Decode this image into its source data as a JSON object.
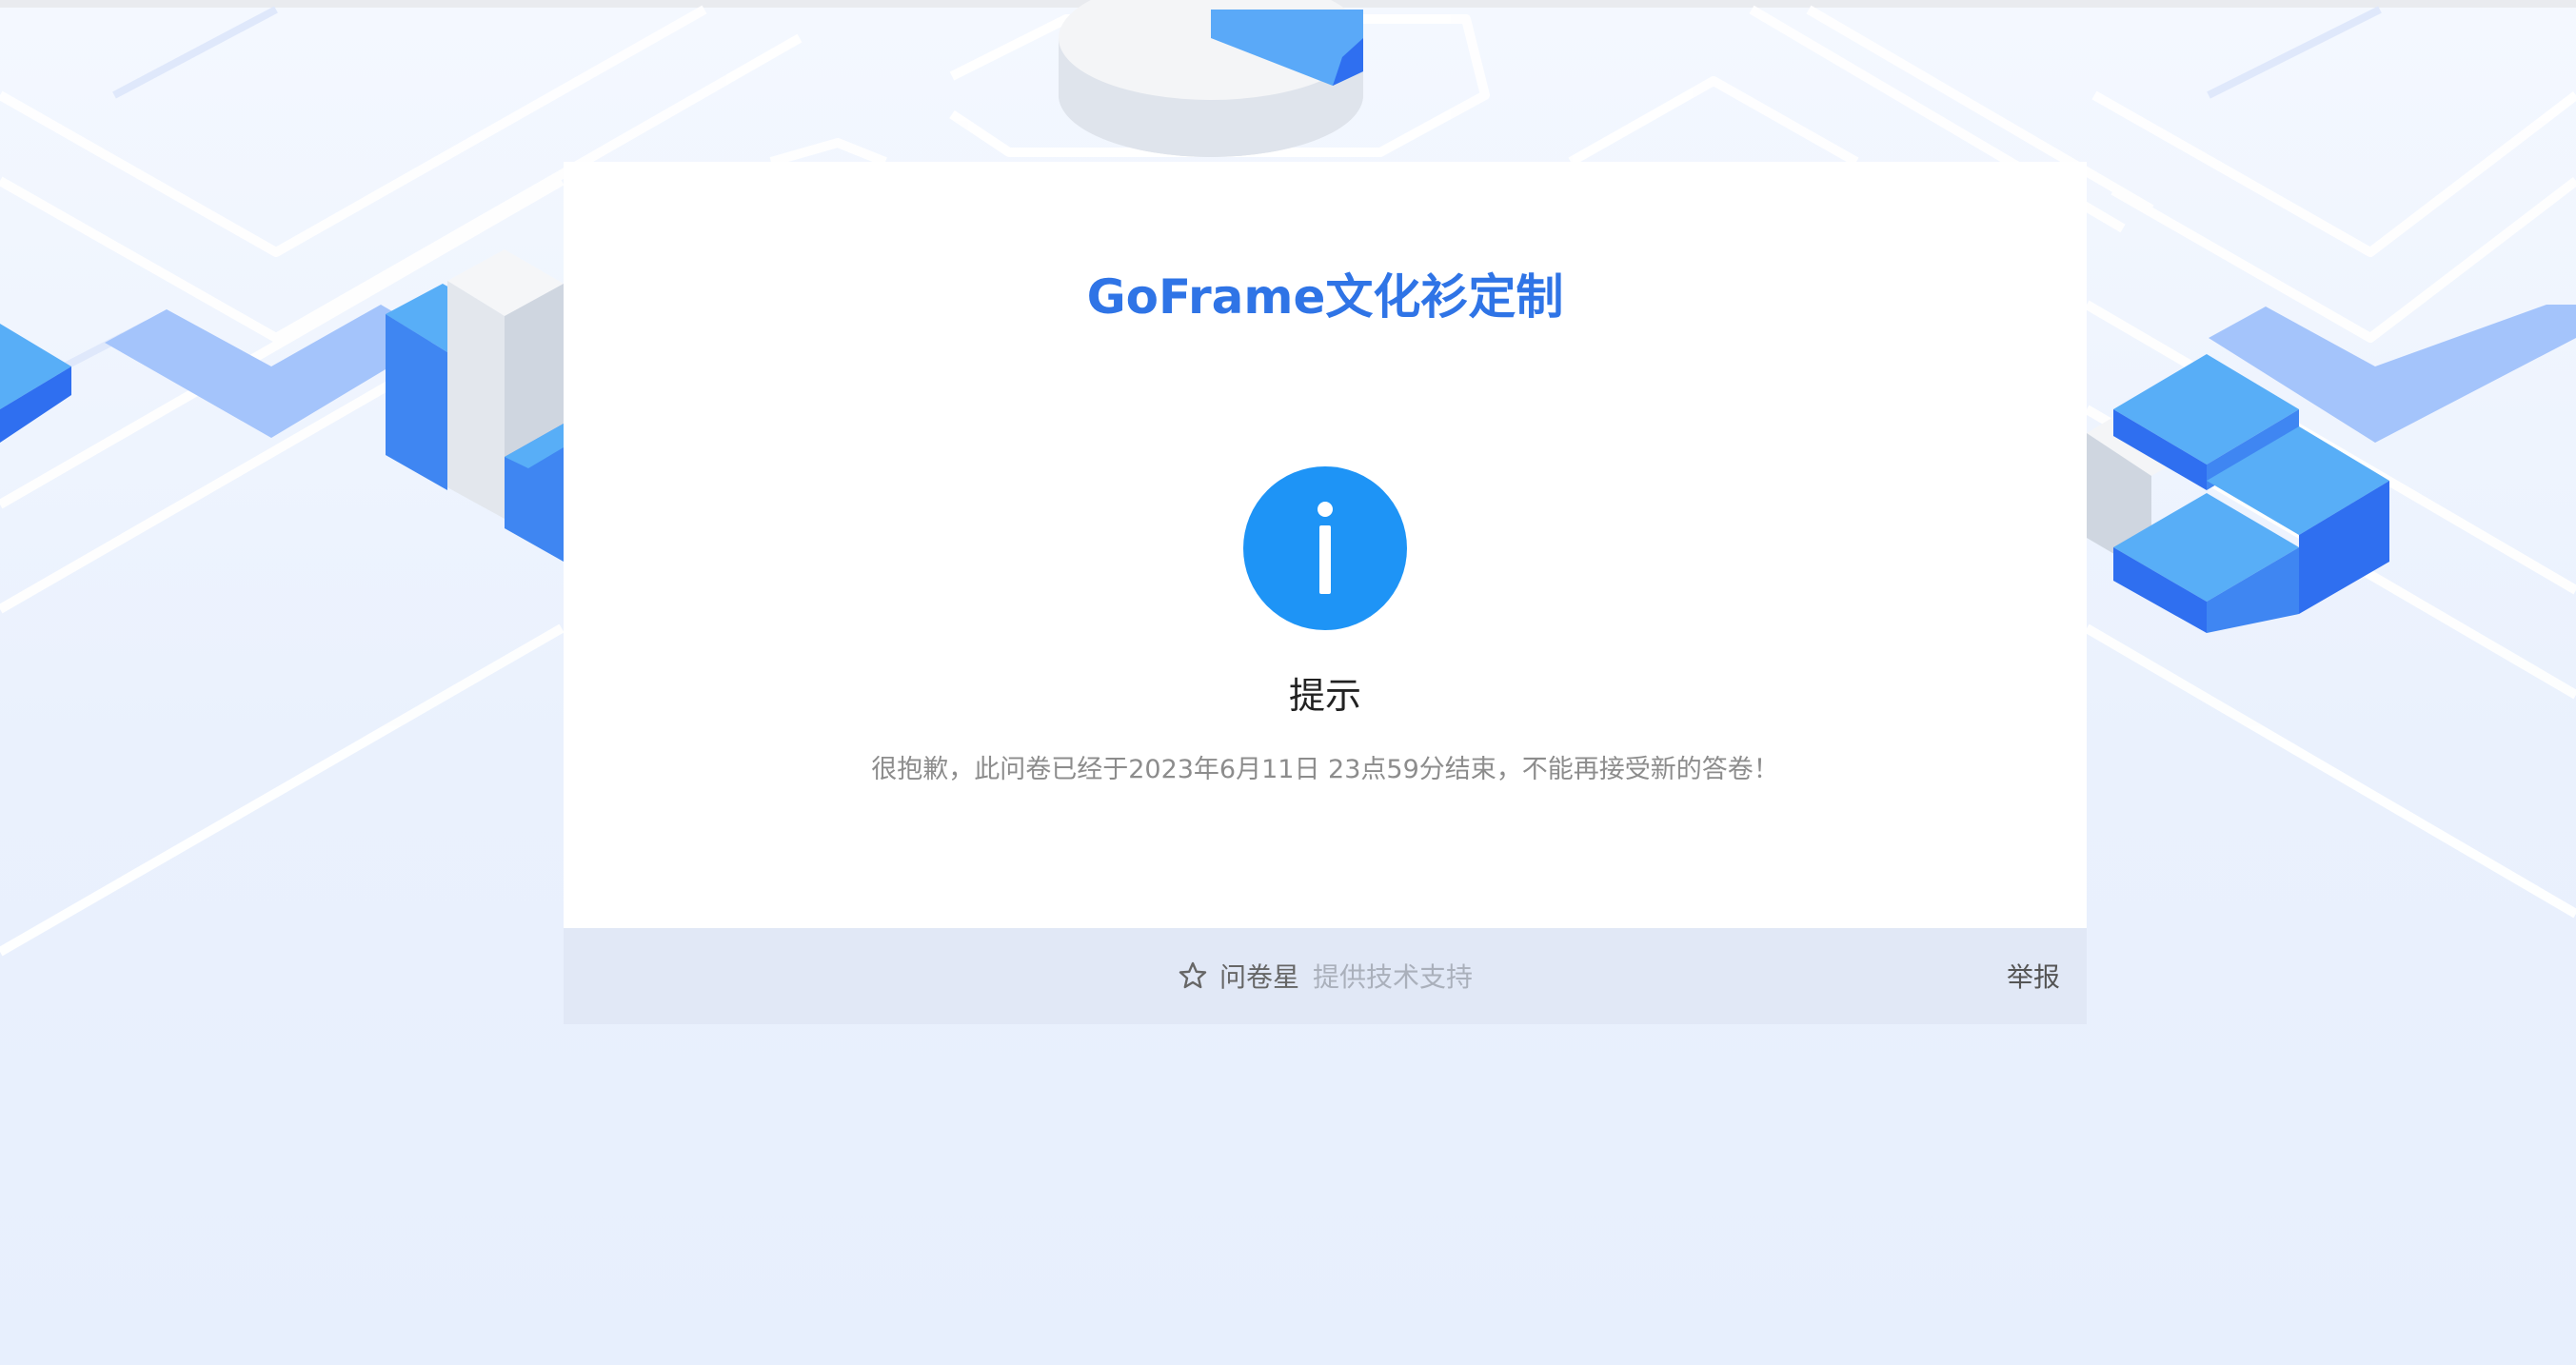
{
  "survey": {
    "title": "GoFrame文化衫定制"
  },
  "notice": {
    "icon": "info-circle-icon",
    "heading": "提示",
    "message": "很抱歉，此问卷已经于2023年6月11日 23点59分结束，不能再接受新的答卷！"
  },
  "footer": {
    "brand_icon": "star-outline-icon",
    "brand_name": "问卷星",
    "brand_support": "提供技术支持",
    "report_label": "举报"
  },
  "colors": {
    "accent": "#2f74e6",
    "info_icon": "#1e94f6",
    "page_bg": "#eaf1fd",
    "footer_bg": "#e1e8f6"
  }
}
